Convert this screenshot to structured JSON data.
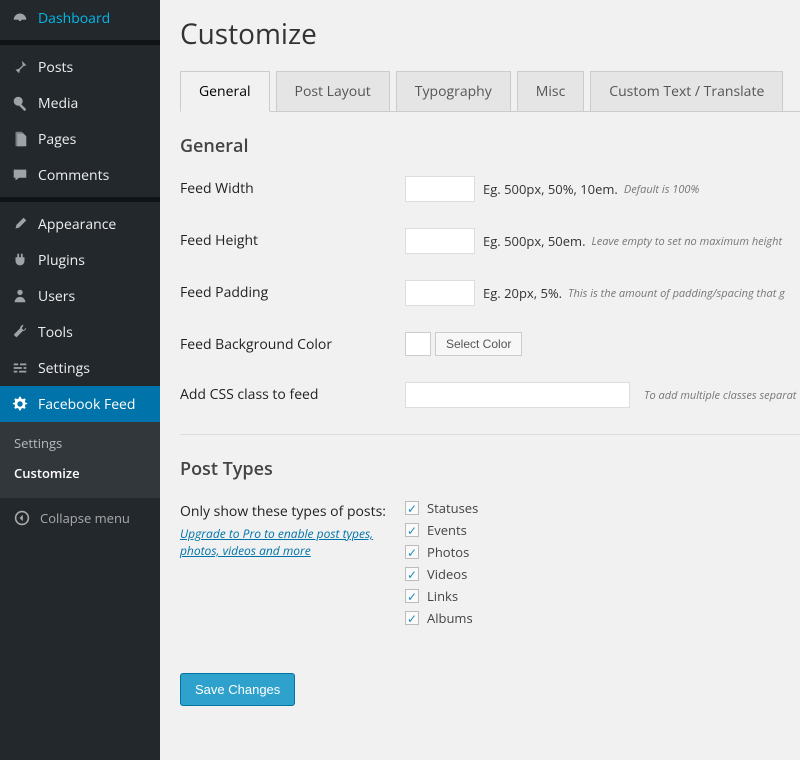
{
  "sidebar": {
    "items": [
      {
        "label": "Dashboard",
        "icon": "dashboard"
      },
      {
        "label": "Posts",
        "icon": "pin"
      },
      {
        "label": "Media",
        "icon": "media"
      },
      {
        "label": "Pages",
        "icon": "pages"
      },
      {
        "label": "Comments",
        "icon": "comments"
      },
      {
        "label": "Appearance",
        "icon": "brush"
      },
      {
        "label": "Plugins",
        "icon": "plug"
      },
      {
        "label": "Users",
        "icon": "user"
      },
      {
        "label": "Tools",
        "icon": "wrench"
      },
      {
        "label": "Settings",
        "icon": "sliders"
      },
      {
        "label": "Facebook Feed",
        "icon": "gear"
      }
    ],
    "submenu": {
      "items": [
        "Settings",
        "Customize"
      ],
      "current": "Customize"
    },
    "collapse": "Collapse menu"
  },
  "page": {
    "title": "Customize"
  },
  "tabs": {
    "items": [
      "General",
      "Post Layout",
      "Typography",
      "Misc",
      "Custom Text / Translate"
    ],
    "active": "General"
  },
  "sections": {
    "general": {
      "title": "General",
      "rows": {
        "feed_width": {
          "label": "Feed Width",
          "value": "",
          "hint": "Eg. 500px, 50%, 10em.",
          "hint_italic": "Default is 100%"
        },
        "feed_height": {
          "label": "Feed Height",
          "value": "",
          "hint": "Eg. 500px, 50em.",
          "hint_italic": "Leave empty to set no maximum height"
        },
        "feed_padding": {
          "label": "Feed Padding",
          "value": "",
          "hint": "Eg. 20px, 5%.",
          "hint_italic": "This is the amount of padding/spacing that g"
        },
        "bg_color": {
          "label": "Feed Background Color",
          "button": "Select Color"
        },
        "css_class": {
          "label": "Add CSS class to feed",
          "value": "",
          "hint_italic": "To add multiple classes separat"
        }
      }
    },
    "post_types": {
      "title": "Post Types",
      "label": "Only show these types of posts:",
      "upgrade": "Upgrade to Pro to enable post types, photos, videos and more",
      "options": [
        "Statuses",
        "Events",
        "Photos",
        "Videos",
        "Links",
        "Albums"
      ]
    }
  },
  "buttons": {
    "save": "Save Changes"
  }
}
